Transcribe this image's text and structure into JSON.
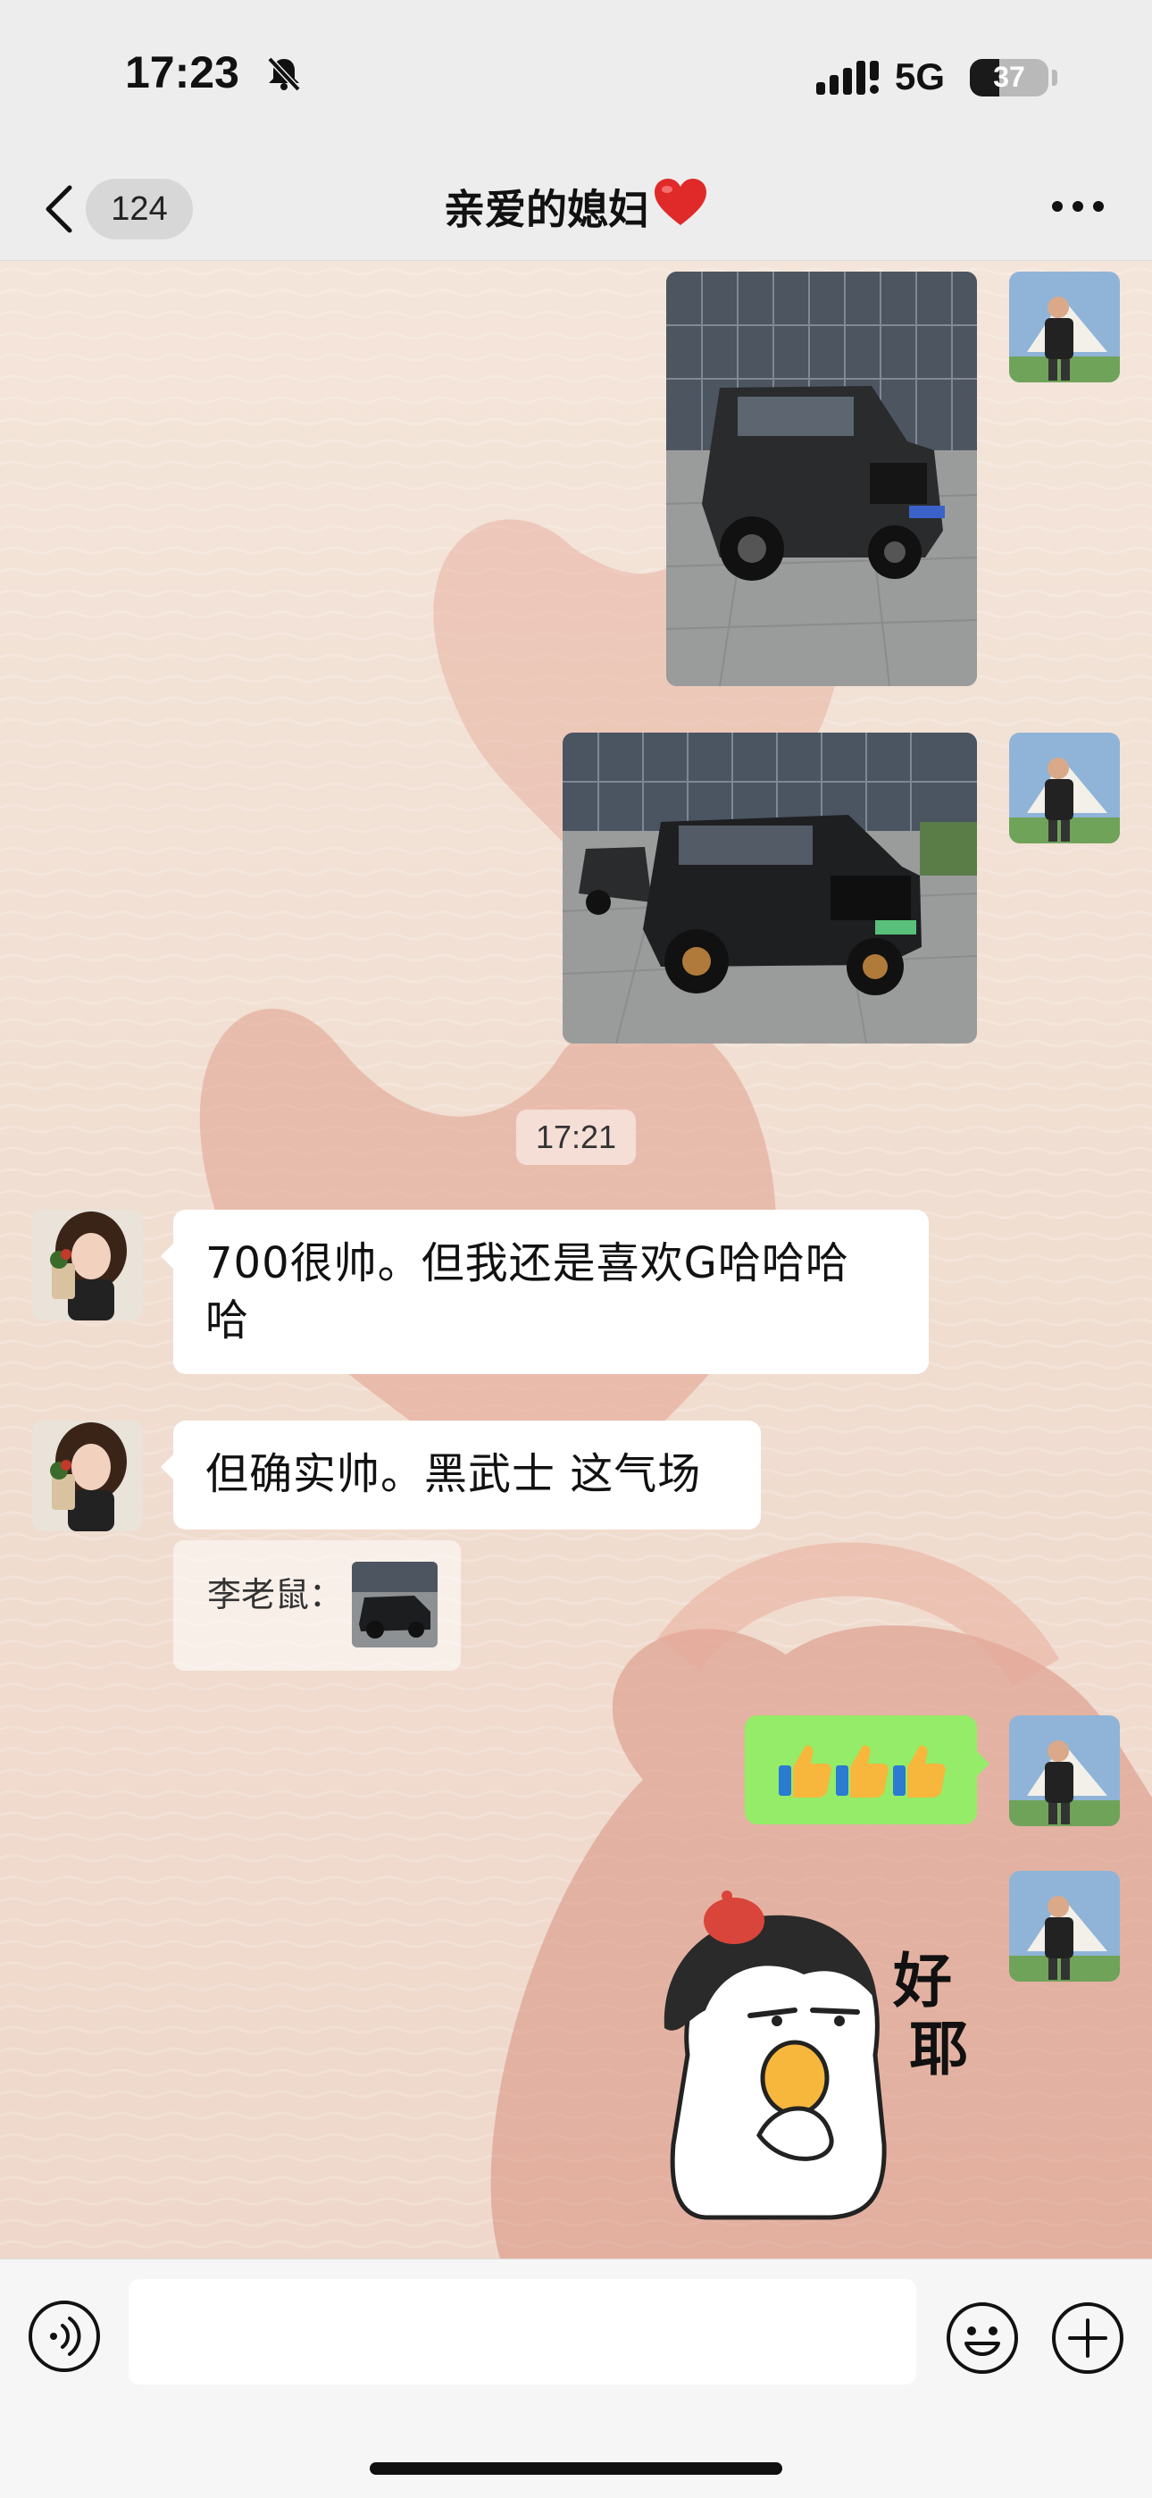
{
  "status_bar": {
    "time": "17:23",
    "network": "5G",
    "battery_percent": 37,
    "battery_label": "37",
    "silent_mode_icon": "bell-slash-icon",
    "signal_icon": "cellular-signal-icon"
  },
  "nav": {
    "back_icon": "chevron-left-icon",
    "unread_count": "124",
    "title": "亲爱的媳妇",
    "title_emoji": "red-heart",
    "more_icon": "ellipsis-icon"
  },
  "messages": [
    {
      "side": "right",
      "type": "image",
      "content": "black-mercedes-g-class-photo"
    },
    {
      "side": "right",
      "type": "image",
      "content": "black-tank-700-suv-photo"
    },
    {
      "type": "timestamp",
      "text": "17:21"
    },
    {
      "side": "left",
      "type": "text",
      "text": "700很帅。但我还是喜欢G哈哈哈哈"
    },
    {
      "side": "left",
      "type": "text",
      "text": "但确实帅。黑武士 这气场"
    },
    {
      "side": "left",
      "type": "quote",
      "author": "李老鼠："
    },
    {
      "side": "right",
      "type": "text",
      "emoji": "👍👍👍"
    },
    {
      "side": "right",
      "type": "sticker",
      "text": "好耶"
    }
  ],
  "chat": {
    "timestamp": "17:21",
    "msg_1": "700很帅。但我还是喜欢G哈哈哈",
    "msg_1_line2": "哈",
    "msg_2": "但确实帅。黑武士 这气场",
    "quote_author": "李老鼠：",
    "sticker_text_1": "好",
    "sticker_text_2": "耶"
  },
  "input_bar": {
    "voice_icon": "voice-icon",
    "placeholder": "",
    "emoji_icon": "smiley-icon",
    "plus_icon": "plus-circle-icon"
  },
  "colors": {
    "nav_bg": "#ededed",
    "sent_bubble": "#95ec69",
    "received_bubble": "#ffffff",
    "wallpaper": "#f1e3d8",
    "heart_red": "#e02a2a"
  }
}
